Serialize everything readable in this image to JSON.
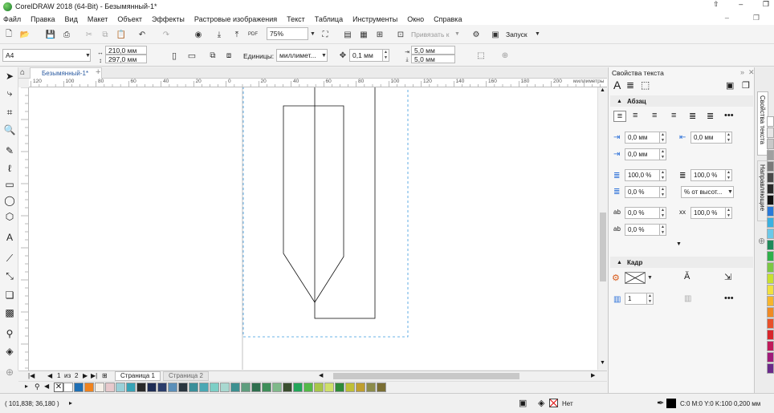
{
  "window": {
    "title": "CorelDRAW 2018 (64-Bit) - Безымянный-1*"
  },
  "menu": {
    "items": [
      "Файл",
      "Правка",
      "Вид",
      "Макет",
      "Объект",
      "Эффекты",
      "Растровые изображения",
      "Текст",
      "Таблица",
      "Инструменты",
      "Окно",
      "Справка"
    ]
  },
  "toolbar": {
    "zoom": "75%",
    "snap_label": "Привязать к",
    "launch_label": "Запуск"
  },
  "property_bar": {
    "page_size": "A4",
    "width": "210,0 мм",
    "height": "297,0 мм",
    "units_label": "Единицы:",
    "units_value": "миллимет...",
    "nudge": "0,1 мм",
    "dup_x": "5,0 мм",
    "dup_y": "5,0 мм"
  },
  "document": {
    "tab_name": "Безымянный-1*"
  },
  "ruler": {
    "h_labels": [
      "120",
      "100",
      "80",
      "60",
      "40",
      "20",
      "0",
      "20",
      "40",
      "60",
      "80",
      "100",
      "120",
      "140",
      "160",
      "180",
      "200"
    ],
    "h_unit": "миллиметры"
  },
  "page_nav": {
    "current": "1",
    "of_label": "из",
    "total": "2",
    "pages": [
      "Страница 1",
      "Страница 2"
    ]
  },
  "palette": {
    "colors": [
      "#ffffff",
      "#1f6fb4",
      "#f0831e",
      "#f5f0e8",
      "#e8c9cc",
      "#9ad0d8",
      "#37a3b6",
      "#2a2a2a",
      "#1f2d55",
      "#2c3e6c",
      "#5b8fb9",
      "#2a3640",
      "#3a8f9a",
      "#4aa8b4",
      "#7ccfc6",
      "#a8d8d0",
      "#3c9090",
      "#5e9e7e",
      "#2e6f4e",
      "#3f8f5a",
      "#7fb98a",
      "#3a4e2f",
      "#23a55a",
      "#54b948",
      "#a8c64a",
      "#cfe06b",
      "#2e8b3a",
      "#bfbf37",
      "#bf9f2f",
      "#8c8c4b",
      "#7a6e33"
    ]
  },
  "status": {
    "coords": "( 101,838; 36,180 )",
    "fill_label": "Нет",
    "outline": "C:0 M:0 Y:0 K:100  0,200 мм"
  },
  "docker": {
    "title": "Свойства текста",
    "paragraph_label": "Абзац",
    "left_indent": "0,0 мм",
    "first_line": "0,0 мм",
    "right_indent": "0,0 мм",
    "line_spacing": "100,0 %",
    "before_para": "100,0 %",
    "after_para": "0,0 %",
    "spacing_unit": "% от высот...",
    "char_spacing": "0,0 %",
    "word_spacing": "100,0 %",
    "lang_spacing": "0,0 %",
    "frame_label": "Кадр",
    "columns": "1"
  },
  "vtabs": {
    "tab1": "Свойства текста",
    "tab2": "Направляющие"
  },
  "right_palette": [
    "#ffffff",
    "#e6e6e6",
    "#c8c8c8",
    "#a0a0a0",
    "#7a7a7a",
    "#4a4a4a",
    "#2a2a2a",
    "#111111",
    "#2a7ad8",
    "#3ab0e0",
    "#6cc8e8",
    "#1e8a5a",
    "#2fb04a",
    "#7cc844",
    "#c8e030",
    "#f0e040",
    "#f7b52c",
    "#f08a24",
    "#e8502a",
    "#d8262a",
    "#c01a5a",
    "#a01a7a",
    "#6a2a8a"
  ]
}
